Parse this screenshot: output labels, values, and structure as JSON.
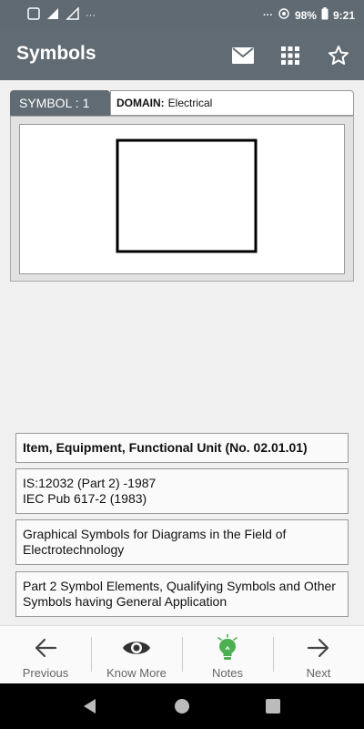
{
  "status_bar": {
    "left_indicators": [
      "VoLTE",
      "4G",
      "signal",
      "no-signal",
      "..."
    ],
    "right_indicators": [
      "...",
      "hotspot"
    ],
    "battery": "98%",
    "time": "9:21"
  },
  "app_bar": {
    "title": "Symbols",
    "actions": [
      "mail-icon",
      "grid-icon",
      "star-icon"
    ]
  },
  "tabs": {
    "symbol_label": "SYMBOL :",
    "symbol_number": "1",
    "domain_label": "DOMAIN:",
    "domain_value": "Electrical"
  },
  "symbol": {
    "shape": "rectangle",
    "stroke_color": "#000000"
  },
  "info": {
    "title": "Item, Equipment, Functional Unit (No. 02.01.01)",
    "standard_line1": "IS:12032 (Part 2) -1987",
    "standard_line2": "IEC Pub 617-2 (1983)",
    "description1": "Graphical Symbols for Diagrams in the Field of Electrotechnology",
    "description2": "Part 2 Symbol Elements, Qualifying Symbols and Other Symbols having General Application"
  },
  "bottom_nav": {
    "previous": "Previous",
    "know_more": "Know More",
    "notes": "Notes",
    "next": "Next"
  },
  "colors": {
    "app_bar": "#616b73",
    "notes_accent": "#4caf50"
  }
}
